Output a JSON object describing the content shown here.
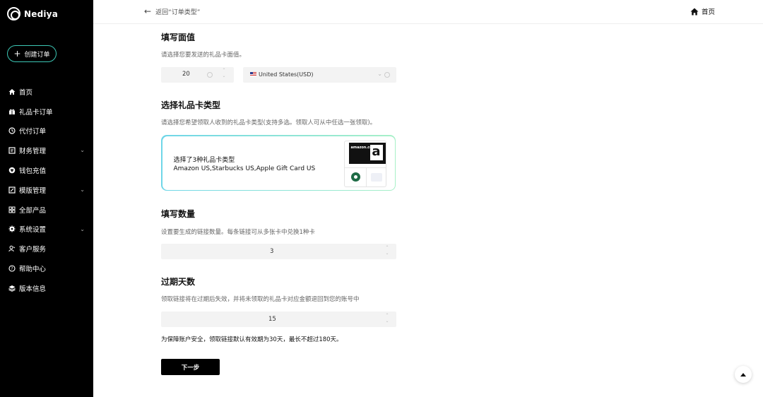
{
  "brand": {
    "name": "Nediya",
    "accent": "#3cc7b5"
  },
  "sidebar": {
    "create_label": "创建订单",
    "items": [
      {
        "label": "首页",
        "icon": "home-icon"
      },
      {
        "label": "礼品卡订单",
        "icon": "gift-icon"
      },
      {
        "label": "代付订单",
        "icon": "proxy-pay-icon"
      },
      {
        "label": "财务管理",
        "icon": "finance-icon"
      },
      {
        "label": "钱包充值",
        "icon": "wallet-icon"
      },
      {
        "label": "模版管理",
        "icon": "template-icon"
      },
      {
        "label": "全部产品",
        "icon": "products-icon"
      },
      {
        "label": "系统设置",
        "icon": "gear-icon"
      },
      {
        "label": "客户服务",
        "icon": "support-icon"
      },
      {
        "label": "帮助中心",
        "icon": "help-icon"
      },
      {
        "label": "版本信息",
        "icon": "version-icon"
      }
    ]
  },
  "topbar": {
    "back_label": "返回“订单类型”",
    "home_label": "首页"
  },
  "face_value": {
    "title": "填写面值",
    "desc": "请选择您要发送的礼品卡面值。",
    "amount": "20",
    "currency": "United States(USD)"
  },
  "card_type": {
    "title": "选择礼品卡类型",
    "desc": "请选择您希望领取人收到的礼品卡类型(支持多选。领取人可从中任选一张领取)。",
    "selected_count_text": "选择了3种礼品卡类型",
    "selected_names": "Amazon US,Starbucks US,Apple Gift Card US",
    "amazon_word": "amazon.com"
  },
  "quantity": {
    "title": "填写数量",
    "desc": "设置要生成的链接数量。每条链接可从多张卡中兑换1种卡",
    "value": "3"
  },
  "expiry": {
    "title": "过期天数",
    "desc": "领取链接将在过期后失效，并将未领取的礼品卡对应金额退回到您的账号中",
    "value": "15"
  },
  "note": "为保障账户安全，领取链接默认有效期为30天，最长不超过180天。",
  "next_label": "下一步"
}
